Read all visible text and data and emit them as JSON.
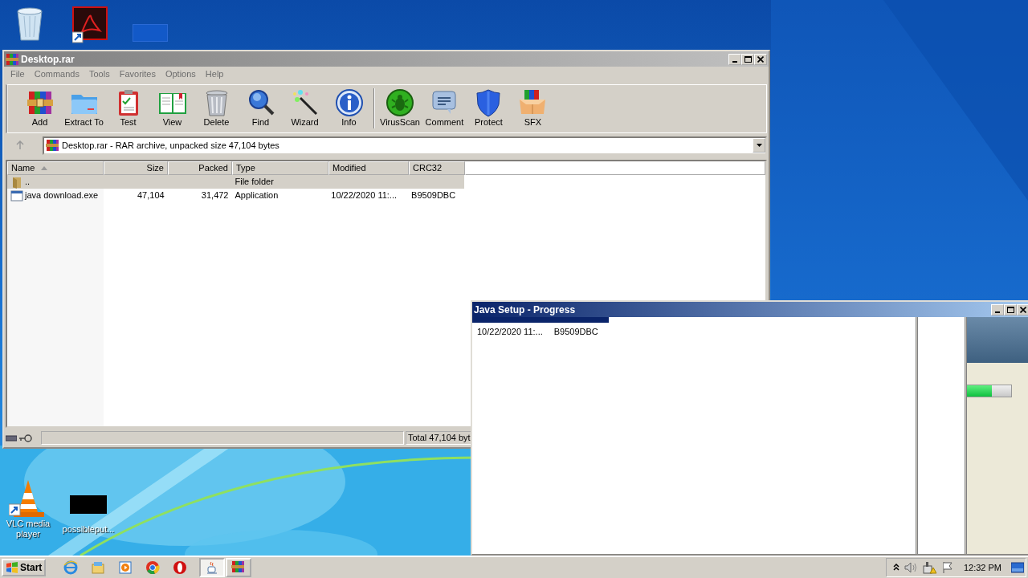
{
  "desktop_icons": [
    {
      "label": "VLC media player"
    },
    {
      "label": "possibleput..."
    }
  ],
  "winrar": {
    "title": "Desktop.rar",
    "menu": [
      "File",
      "Commands",
      "Tools",
      "Favorites",
      "Options",
      "Help"
    ],
    "toolbar": [
      [
        "Add",
        "Extract To",
        "Test",
        "View",
        "Delete",
        "Find",
        "Wizard",
        "Info"
      ],
      [
        "VirusScan",
        "Comment",
        "Protect",
        "SFX"
      ]
    ],
    "address": "Desktop.rar - RAR archive, unpacked size 47,104 bytes",
    "columns": [
      {
        "label": "Name",
        "sorted": true
      },
      {
        "label": "Size",
        "sorted": false
      },
      {
        "label": "Packed",
        "sorted": false
      },
      {
        "label": "Type",
        "sorted": false
      },
      {
        "label": "Modified",
        "sorted": false
      },
      {
        "label": "CRC32",
        "sorted": false
      }
    ],
    "rows": [
      {
        "kind": "folder",
        "selected": true,
        "name": "..",
        "type": "File folder"
      },
      {
        "kind": "file",
        "selected": false,
        "name": "java download.exe",
        "size": "47,104",
        "packed": "31,472",
        "type": "Application",
        "modified": "10/22/2020 11:...",
        "crc32": "B9509DBC"
      }
    ],
    "status": "Total 47,104 byt"
  },
  "java_setup": {
    "title": "Java Setup - Progress",
    "residue": [
      "10/22/2020 11:...",
      "B9509DBC"
    ],
    "progress": {
      "level": 0.57
    }
  },
  "taskbar": {
    "start": "Start",
    "tasks": [
      {
        "selected": true
      },
      {
        "selected": false
      }
    ],
    "clock": "12:32 PM"
  }
}
